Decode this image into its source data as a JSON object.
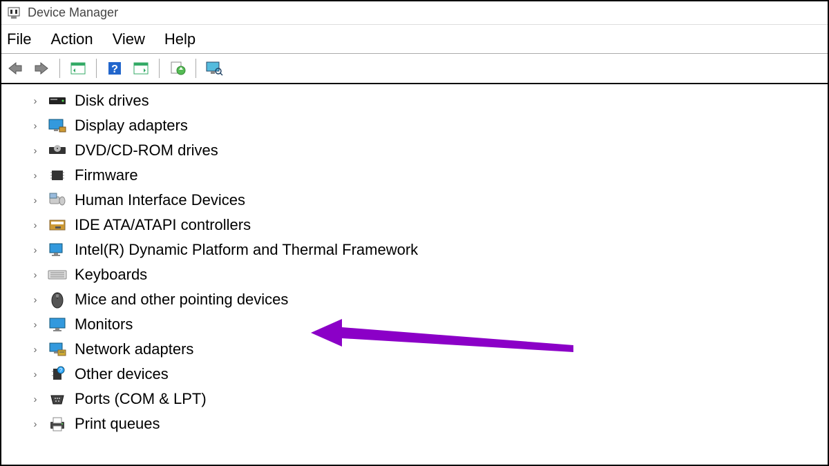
{
  "window": {
    "title": "Device Manager"
  },
  "menu": {
    "items": [
      "File",
      "Action",
      "View",
      "Help"
    ]
  },
  "toolbar": {
    "back": "back-icon",
    "forward": "forward-icon",
    "properties": "properties-icon",
    "help": "help-icon",
    "scan": "scan-icon",
    "refresh": "refresh-icon",
    "monitor": "monitor-icon"
  },
  "tree": {
    "items": [
      {
        "icon": "disk-drive-icon",
        "label": "Disk drives"
      },
      {
        "icon": "display-adapter-icon",
        "label": "Display adapters"
      },
      {
        "icon": "dvd-drive-icon",
        "label": "DVD/CD-ROM drives"
      },
      {
        "icon": "firmware-icon",
        "label": "Firmware"
      },
      {
        "icon": "hid-icon",
        "label": "Human Interface Devices"
      },
      {
        "icon": "ide-icon",
        "label": "IDE ATA/ATAPI controllers"
      },
      {
        "icon": "intel-icon",
        "label": "Intel(R) Dynamic Platform and Thermal Framework"
      },
      {
        "icon": "keyboard-icon",
        "label": "Keyboards"
      },
      {
        "icon": "mouse-icon",
        "label": "Mice and other pointing devices"
      },
      {
        "icon": "monitor-icon",
        "label": "Monitors"
      },
      {
        "icon": "network-icon",
        "label": "Network adapters"
      },
      {
        "icon": "other-icon",
        "label": "Other devices"
      },
      {
        "icon": "port-icon",
        "label": "Ports (COM & LPT)"
      },
      {
        "icon": "print-icon",
        "label": "Print queues"
      }
    ]
  },
  "annotation": {
    "color": "#8b00c7"
  }
}
